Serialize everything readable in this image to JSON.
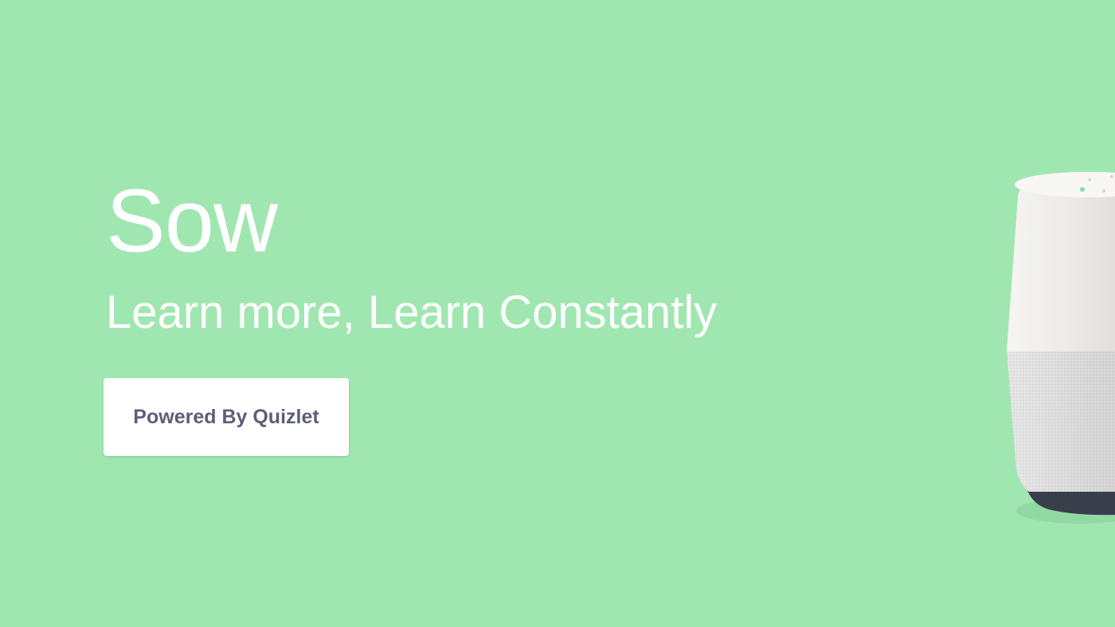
{
  "hero": {
    "title": "Sow",
    "subtitle": "Learn more, Learn Constantly"
  },
  "cta": {
    "label": "Powered By Quizlet"
  },
  "device": {
    "icon": "smart-speaker-icon"
  },
  "colors": {
    "background": "#a0e6b0",
    "hero_text": "#ffffff",
    "button_bg": "#ffffff",
    "button_text": "#5b5f78",
    "speaker_body": "#efede9",
    "speaker_mesh": "#d9d9d9",
    "speaker_base": "#3a3d4a",
    "led": "#7fe39a"
  }
}
